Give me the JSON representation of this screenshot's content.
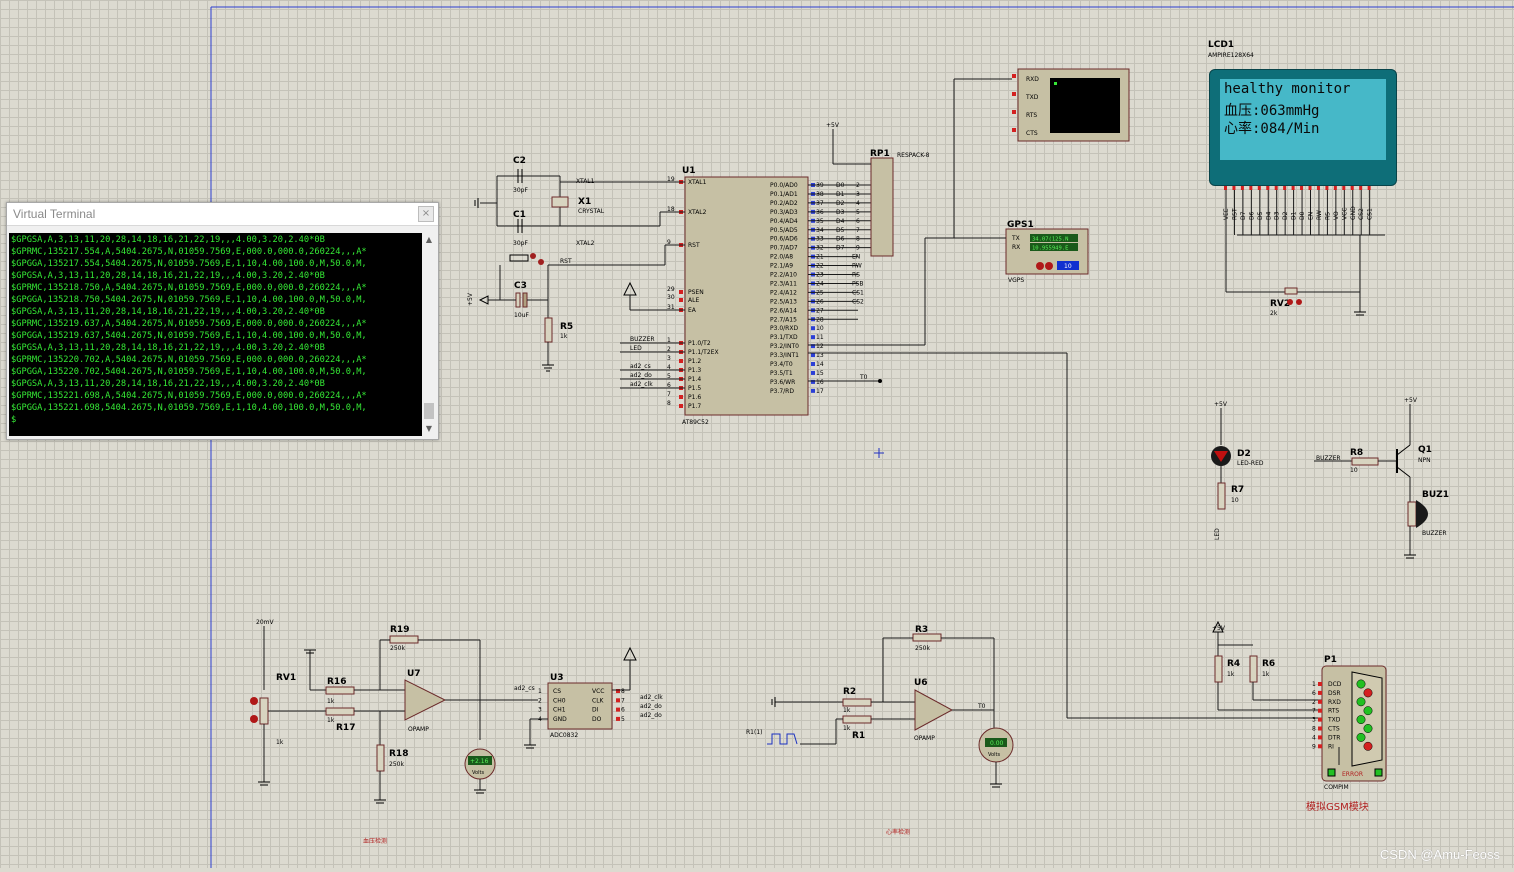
{
  "schematic": {
    "u1": {
      "ref": "U1",
      "part": "AT89C52",
      "left_pins": [
        "XTAL1",
        "XTAL2",
        "RST",
        "PSEN",
        "ALE",
        "EA",
        "P1.0/T2",
        "P1.1/T2EX",
        "P1.2",
        "P1.3",
        "P1.4",
        "P1.5",
        "P1.6",
        "P1.7"
      ],
      "left_nums": [
        "19",
        "18",
        "9",
        "29",
        "30",
        "31",
        "1",
        "2",
        "3",
        "4",
        "5",
        "6",
        "7",
        "8"
      ],
      "right_pins": [
        "P0.0/AD0",
        "P0.1/AD1",
        "P0.2/AD2",
        "P0.3/AD3",
        "P0.4/AD4",
        "P0.5/AD5",
        "P0.6/AD6",
        "P0.7/AD7",
        "P2.0/A8",
        "P2.1/A9",
        "P2.2/A10",
        "P2.3/A11",
        "P2.4/A12",
        "P2.5/A13",
        "P2.6/A14",
        "P2.7/A15",
        "P3.0/RXD",
        "P3.1/TXD",
        "P3.2/INT0",
        "P3.3/INT1",
        "P3.4/T0",
        "P3.5/T1",
        "P3.6/WR",
        "P3.7/RD"
      ],
      "right_nums": [
        "39",
        "38",
        "37",
        "36",
        "35",
        "34",
        "33",
        "32",
        "21",
        "22",
        "23",
        "24",
        "25",
        "26",
        "27",
        "28",
        "10",
        "11",
        "12",
        "13",
        "14",
        "15",
        "16",
        "17"
      ],
      "bus_labels": [
        "D0",
        "D1",
        "D2",
        "D3",
        "D4",
        "D5",
        "D6",
        "D7",
        "EN",
        "RW",
        "RS",
        "PSB",
        "CS1",
        "CS2"
      ],
      "p1_labels": [
        "BUZZER",
        "LED",
        "ad2_cs",
        "ad2_do",
        "ad2_clk"
      ],
      "t0_label": "T0"
    },
    "x1": {
      "ref": "X1",
      "part": "CRYSTAL"
    },
    "c2": {
      "ref": "C2",
      "val": "30pF"
    },
    "c1": {
      "ref": "C1",
      "val": "30pF"
    },
    "c3": {
      "ref": "C3",
      "val": "10uF"
    },
    "r5": {
      "ref": "R5",
      "val": "1k"
    },
    "xtal1": "XTAL1",
    "xtal2": "XTAL2",
    "rst": "RST",
    "plus5v": "+5V",
    "rp1": {
      "ref": "RP1",
      "part": "RESPACK-8"
    },
    "terminal_pins": [
      "RXD",
      "TXD",
      "RTS",
      "CTS"
    ],
    "gps": {
      "ref": "GPS1",
      "part": "VGPS",
      "tx": "TX",
      "rx": "RX",
      "tx_val": "34.07(125.N",
      "rx_val": "10.955949.E",
      "num": "10"
    },
    "lcd": {
      "ref": "LCD1",
      "part": "AMPIRE128X64",
      "line1": "healthy monitor",
      "line2": "血压:063mmHg",
      "line3": "心率:084/Min",
      "pins": [
        "VEE",
        "RST",
        "D7",
        "D6",
        "D5",
        "D4",
        "D3",
        "D2",
        "D1",
        "D0",
        "EN",
        "RW",
        "RS",
        "VO",
        "VCC",
        "GND",
        "CS2",
        "CS1"
      ]
    },
    "rv2": {
      "ref": "RV2",
      "val": "2k"
    },
    "d2": {
      "ref": "D2",
      "part": "LED-RED"
    },
    "r7": {
      "ref": "R7",
      "val": "10",
      "net": "LED"
    },
    "q1": {
      "ref": "Q1",
      "part": "NPN"
    },
    "r8": {
      "ref": "R8",
      "val": "10",
      "net": "BUZZER"
    },
    "buz1": {
      "ref": "BUZ1",
      "part": "BUZZER"
    },
    "r4": {
      "ref": "R4",
      "val": "1k"
    },
    "r6": {
      "ref": "R6",
      "val": "1k"
    },
    "p1": {
      "ref": "P1",
      "part": "COMPIM",
      "pins": [
        "DCD",
        "DSR",
        "RXD",
        "RTS",
        "TXD",
        "CTS",
        "DTR",
        "RI"
      ],
      "nums": [
        "1",
        "6",
        "2",
        "7",
        "3",
        "8",
        "4",
        "9"
      ],
      "error": "ERROR",
      "caption": "模拟GSM模块"
    },
    "rv1": {
      "ref": "RV1",
      "val": "1k",
      "src": "20mV"
    },
    "r16": {
      "ref": "R16",
      "val": "1k"
    },
    "r17": {
      "ref": "R17",
      "val": "1k"
    },
    "r18": {
      "ref": "R18",
      "val": "250k"
    },
    "r19": {
      "ref": "R19",
      "val": "250k"
    },
    "u7": {
      "ref": "U7",
      "part": "OPAMP"
    },
    "vm1": {
      "reading": "+2.16",
      "unit": "Volts"
    },
    "u3": {
      "ref": "U3",
      "part": "ADC0832",
      "pins_left": [
        "CS",
        "CH0",
        "CH1",
        "GND"
      ],
      "pins_right": [
        "VCC",
        "CLK",
        "DI",
        "DO"
      ],
      "nums_left": [
        "1",
        "2",
        "3",
        "4"
      ],
      "nums_right": [
        "8",
        "7",
        "6",
        "5"
      ],
      "nets": [
        "ad2_cs",
        "ad2_clk",
        "ad2_do"
      ]
    },
    "caption_bp": "血压检测",
    "r2": {
      "ref": "R2",
      "val": "1k"
    },
    "r1": {
      "ref": "R1",
      "val": "1k",
      "src": "R1(1)"
    },
    "r3": {
      "ref": "R3",
      "val": "250k"
    },
    "u6": {
      "ref": "U6",
      "part": "OPAMP"
    },
    "vm2": {
      "reading": "0.00",
      "unit": "Volts",
      "net": "T0"
    },
    "caption_hr": "心率检测"
  },
  "terminal": {
    "title": "Virtual Terminal",
    "close": "×",
    "lines": [
      "$GPGSA,A,3,13,11,20,28,14,18,16,21,22,19,,,4.00,3.20,2.40*0B",
      "$GPRMC,135217.554,A,5404.2675,N,01059.7569,E,000.0,000.0,260224,,,A*",
      "$GPGGA,135217.554,5404.2675,N,01059.7569,E,1,10,4.00,100.0,M,50.0,M,",
      "$GPGSA,A,3,13,11,20,28,14,18,16,21,22,19,,,4.00,3.20,2.40*0B",
      "$GPRMC,135218.750,A,5404.2675,N,01059.7569,E,000.0,000.0,260224,,,A*",
      "$GPGGA,135218.750,5404.2675,N,01059.7569,E,1,10,4.00,100.0,M,50.0,M,",
      "$GPGSA,A,3,13,11,20,28,14,18,16,21,22,19,,,4.00,3.20,2.40*0B",
      "$GPRMC,135219.637,A,5404.2675,N,01059.7569,E,000.0,000.0,260224,,,A*",
      "$GPGGA,135219.637,5404.2675,N,01059.7569,E,1,10,4.00,100.0,M,50.0,M,",
      "$GPGSA,A,3,13,11,20,28,14,18,16,21,22,19,,,4.00,3.20,2.40*0B",
      "$GPRMC,135220.702,A,5404.2675,N,01059.7569,E,000.0,000.0,260224,,,A*",
      "$GPGGA,135220.702,5404.2675,N,01059.7569,E,1,10,4.00,100.0,M,50.0,M,",
      "$GPGSA,A,3,13,11,20,28,14,18,16,21,22,19,,,4.00,3.20,2.40*0B",
      "$GPRMC,135221.698,A,5404.2675,N,01059.7569,E,000.0,000.0,260224,,,A*",
      "$GPGGA,135221.698,5404.2675,N,01059.7569,E,1,10,4.00,100.0,M,50.0,M,",
      "$"
    ]
  },
  "watermark": "CSDN @Amu-Feoss"
}
